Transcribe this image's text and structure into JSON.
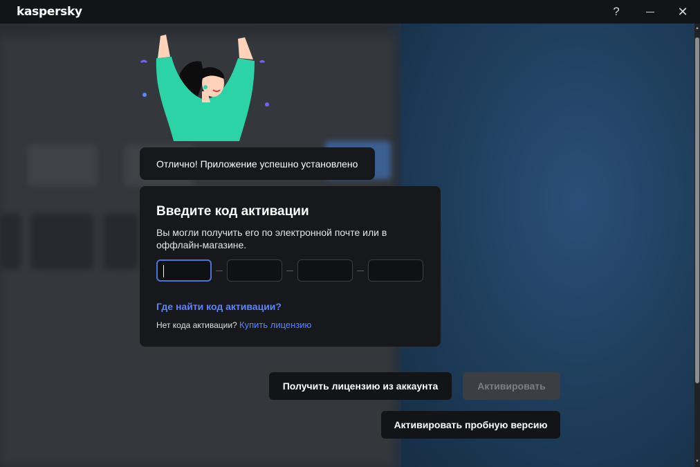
{
  "titlebar": {
    "logo": "kaspersky",
    "help_icon": "?",
    "minimize_icon": "minimize-icon",
    "close_icon": "✕"
  },
  "toast": {
    "text": "Отлично! Приложение успешно установлено"
  },
  "activation": {
    "title": "Введите код активации",
    "description": "Вы могли получить его по электронной почте или в оффлайн-магазине.",
    "code_fields": [
      {
        "value": "",
        "active": true
      },
      {
        "value": "",
        "active": false
      },
      {
        "value": "",
        "active": false
      },
      {
        "value": "",
        "active": false
      }
    ],
    "help_link": "Где найти код активации?",
    "no_code_text": "Нет кода активации?",
    "buy_link": "Купить лицензию"
  },
  "buttons": {
    "account": "Получить лицензию из аккаунта",
    "activate": "Активировать",
    "trial": "Активировать пробную версию"
  },
  "colors": {
    "accent": "#5c84ff",
    "focus_border": "#4f74d9",
    "card_bg": "#16181b",
    "disabled_bg": "#3b3e43",
    "figure_shirt": "#2bd3a6"
  }
}
